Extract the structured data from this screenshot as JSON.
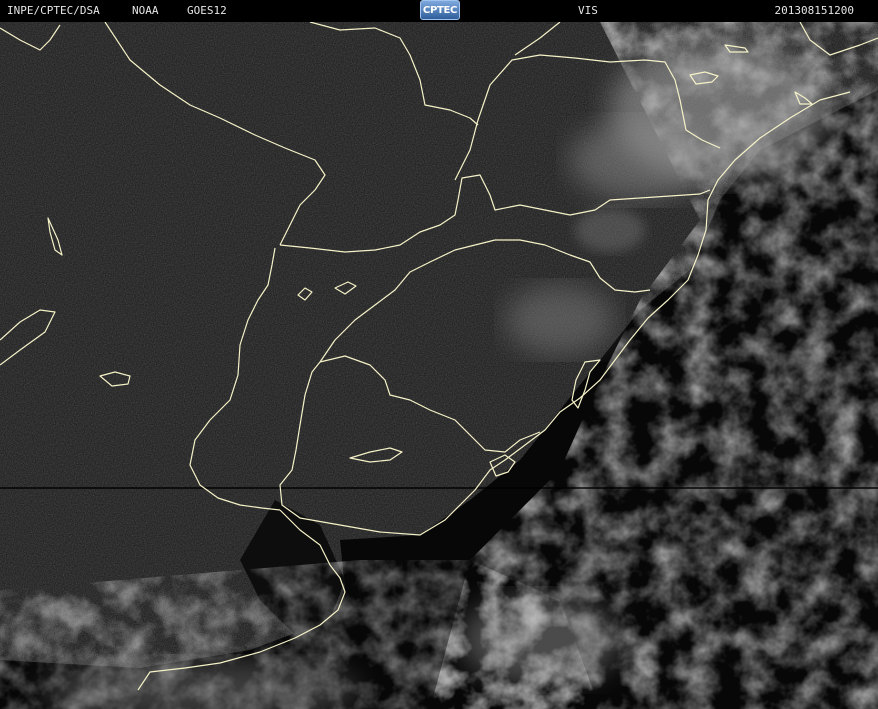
{
  "header": {
    "agency": "INPE/CPTEC/DSA",
    "noaa": "NOAA",
    "satellite": "GOES12",
    "channel": "VIS",
    "timestamp": "201308151200",
    "logo_text": "CPTEC"
  },
  "imagery": {
    "kind": "satellite-visible-image",
    "colors": {
      "background": "#000000",
      "land": "#1c1c1c",
      "coastline": "#f5f2c8",
      "cloud": "#bdbdbd"
    }
  }
}
